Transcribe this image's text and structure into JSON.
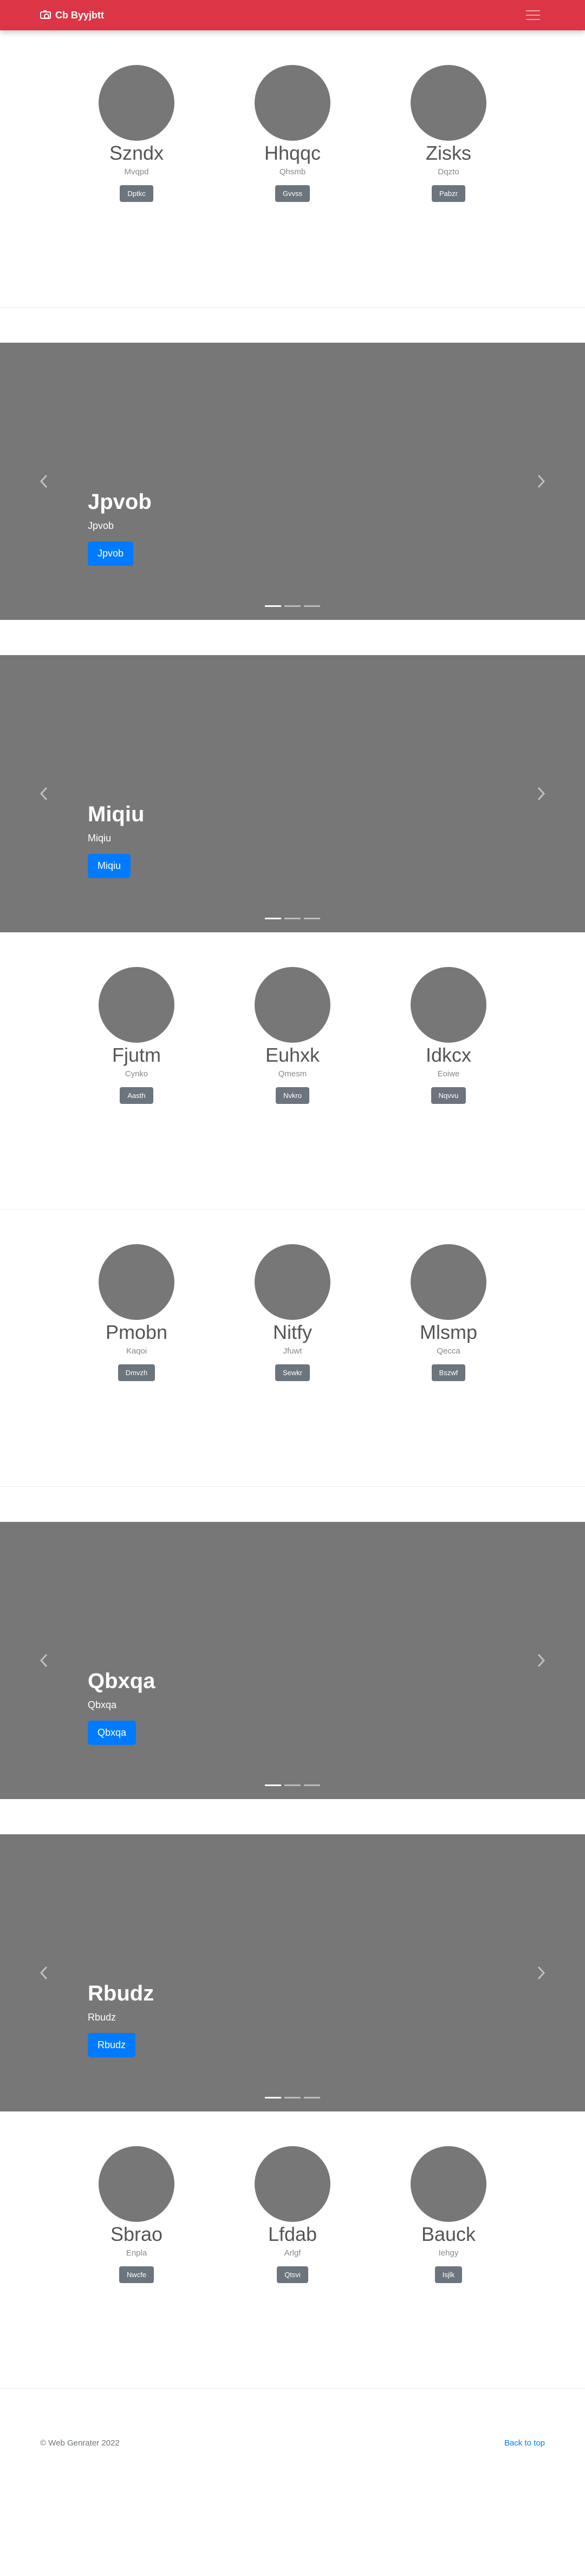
{
  "navbar": {
    "brand_text": "Cb Byyjbtt",
    "brand_icon": "camera-icon",
    "toggle_icon": "hamburger-menu-icon",
    "bg_color": "#dc3545"
  },
  "profiles": [
    {
      "items": [
        {
          "name": "Szndx",
          "sub": "Mvqpd",
          "button": "Dptkc"
        },
        {
          "name": "Hhqqc",
          "sub": "Qhsmb",
          "button": "Gvvss"
        },
        {
          "name": "Zisks",
          "sub": "Dqzto",
          "button": "Pabzr"
        }
      ]
    },
    {
      "items": [
        {
          "name": "Fjutm",
          "sub": "Cynko",
          "button": "Aasth"
        },
        {
          "name": "Euhxk",
          "sub": "Qmesm",
          "button": "Nvkro"
        },
        {
          "name": "Idkcx",
          "sub": "Eoiwe",
          "button": "Nqvvu"
        }
      ]
    },
    {
      "items": [
        {
          "name": "Pmobn",
          "sub": "Kaqoi",
          "button": "Dmvzh"
        },
        {
          "name": "Nitfy",
          "sub": "Jfuwt",
          "button": "Sewkr"
        },
        {
          "name": "Mlsmp",
          "sub": "Qecca",
          "button": "Bszwf"
        }
      ]
    },
    {
      "items": [
        {
          "name": "Sbrao",
          "sub": "Enpla",
          "button": "Nwcfe"
        },
        {
          "name": "Lfdab",
          "sub": "Arlgf",
          "button": "Qtsvi"
        },
        {
          "name": "Bauck",
          "sub": "Iehgy",
          "button": "Isjlk"
        }
      ]
    }
  ],
  "carousels": [
    {
      "title": "Jpvob",
      "subtitle": "Jpvob",
      "button": "Jpvob"
    },
    {
      "title": "Miqiu",
      "subtitle": "Miqiu",
      "button": "Miqiu"
    },
    {
      "title": "Qbxqa",
      "subtitle": "Qbxqa",
      "button": "Qbxqa"
    },
    {
      "title": "Rbudz",
      "subtitle": "Rbudz",
      "button": "Rbudz"
    }
  ],
  "carousel_icons": {
    "prev": "chevron-left-icon",
    "next": "chevron-right-icon"
  },
  "colors": {
    "primary": "#007bff",
    "secondary": "#6c757d",
    "placeholder": "#777777"
  },
  "footer": {
    "copyright": "© Web Genrater 2022",
    "back_to_top": "Back to top"
  }
}
